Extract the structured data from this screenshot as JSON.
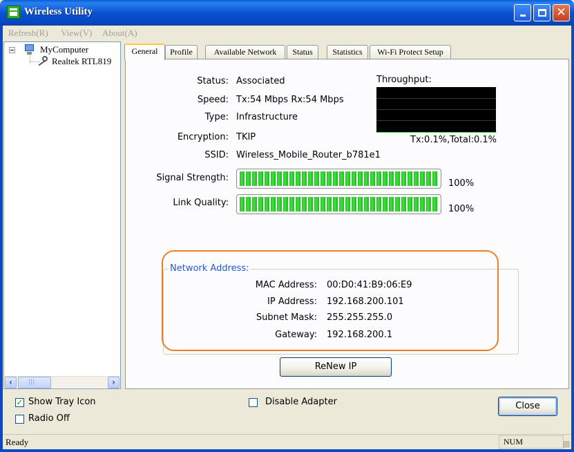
{
  "window": {
    "title": "Wireless Utility",
    "min_glyph": "",
    "max_glyph": "",
    "close_glyph": "✕"
  },
  "menu": {
    "refresh": "Refresh(R)",
    "view": "View(V)",
    "about": "About(A)"
  },
  "tree": {
    "root_label": "MyComputer",
    "adapter_label": "Realtek RTL819",
    "scroll_left": "‹",
    "scroll_right": "›"
  },
  "tabs": [
    "General",
    "Profile",
    "Available Network",
    "Status",
    "Statistics",
    "Wi-Fi Protect Setup"
  ],
  "general": {
    "status_label": "Status:",
    "status_value": "Associated",
    "speed_label": "Speed:",
    "speed_value": "Tx:54 Mbps Rx:54 Mbps",
    "type_label": "Type:",
    "type_value": "Infrastructure",
    "encryption_label": "Encryption:",
    "encryption_value": "TKIP",
    "ssid_label": "SSID:",
    "ssid_value": "Wireless_Mobile_Router_b781e1",
    "throughput_label": "Throughput:",
    "throughput_value": "Tx:0.1%,Total:0.1%",
    "signal_label": "Signal Strength:",
    "signal_value": "100%",
    "signal_level": 1.0,
    "link_label": "Link Quality:",
    "link_value": "100%",
    "link_level": 1.0
  },
  "network": {
    "group_title": "Network Address:",
    "mac_label": "MAC Address:",
    "mac_value": "00:D0:41:B9:06:E9",
    "ip_label": "IP Address:",
    "ip_value": "192.168.200.101",
    "subnet_label": "Subnet Mask:",
    "subnet_value": "255.255.255.0",
    "gateway_label": "Gateway:",
    "gateway_value": "192.168.200.1",
    "renew_label": "ReNew IP"
  },
  "options": {
    "show_tray_label": "Show Tray Icon",
    "show_tray_checked": true,
    "radio_off_label": "Radio Off",
    "radio_off_checked": false,
    "disable_adapter_label": "Disable Adapter",
    "disable_adapter_checked": false,
    "close_label": "Close"
  },
  "statusbar": {
    "text": "Ready",
    "num": "NUM"
  },
  "colors": {
    "titlebar": "#0a52d1",
    "group_title": "#1f5bd8",
    "highlight": "#ef7d25",
    "bar_fill": "#1fc21f"
  }
}
